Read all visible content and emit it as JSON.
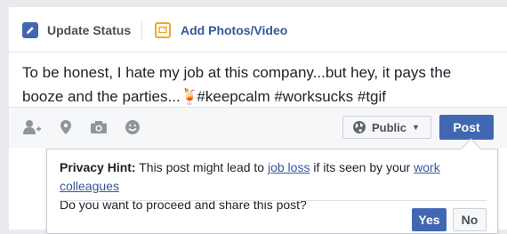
{
  "composer": {
    "tabs": [
      {
        "label": "Update Status",
        "icon": "pencil-icon"
      },
      {
        "label": "Add Photos/Video",
        "icon": "photo-icon"
      }
    ],
    "post_text_before": "To be honest, I hate my job at this company...but hey, it pays the booze and the parties...",
    "post_emoji": "🍹",
    "post_text_after": " #keepcalm #worksucks #tgif",
    "toolbar_icons": [
      "tag-friends-icon",
      "location-pin-icon",
      "camera-icon",
      "emoji-icon"
    ],
    "privacy_label": "Public",
    "post_label": "Post"
  },
  "hint": {
    "title": "Privacy Hint:",
    "text_1": " This post might lead to ",
    "link_1": "job loss",
    "text_2": " if its seen by your ",
    "link_2": "work colleagues",
    "line_2": "Do you want to proceed and share this post?",
    "yes_label": "Yes",
    "no_label": "No"
  },
  "colors": {
    "accent": "#4267b2",
    "link": "#365899",
    "orange": "#f5a623"
  }
}
